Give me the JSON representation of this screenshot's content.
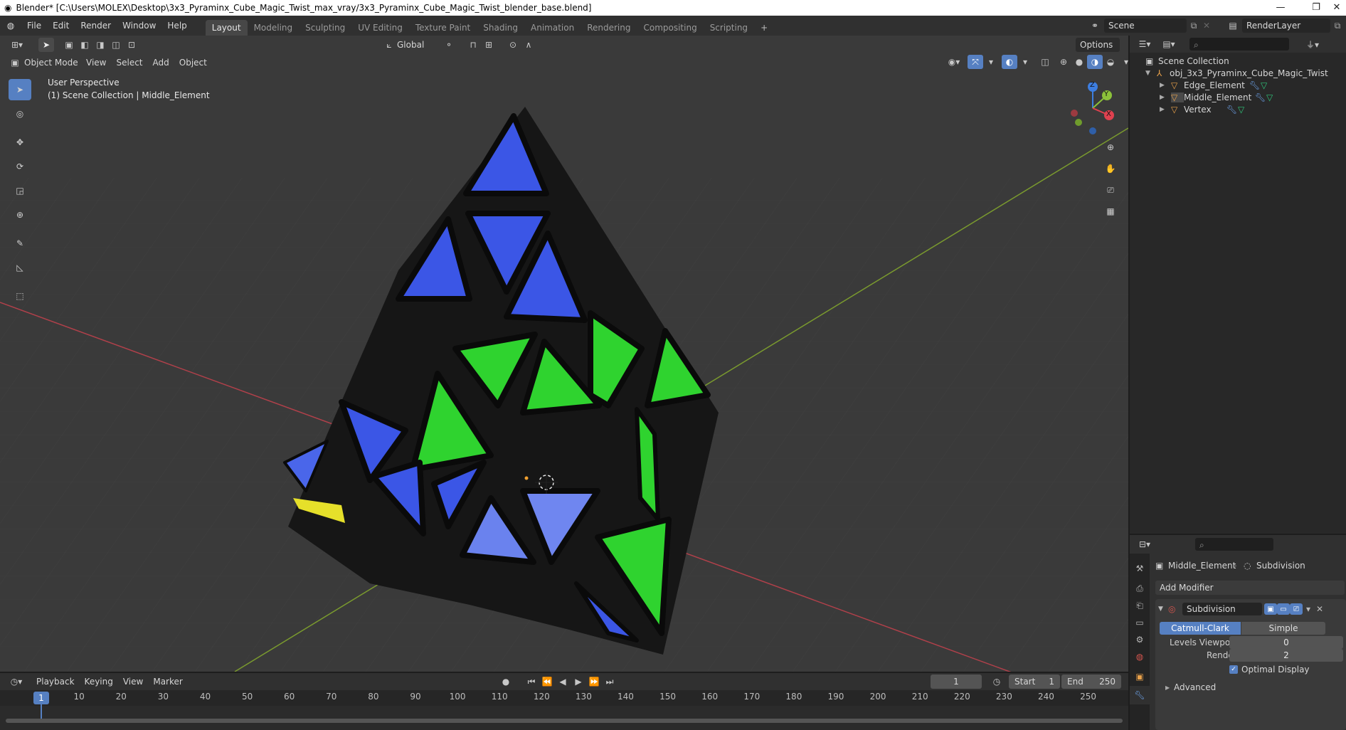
{
  "window": {
    "title": "Blender* [C:\\Users\\MOLEX\\Desktop\\3x3_Pyraminx_Cube_Magic_Twist_max_vray/3x3_Pyraminx_Cube_Magic_Twist_blender_base.blend]",
    "minimize": "—",
    "restore": "❐",
    "close": "✕"
  },
  "menu": [
    "File",
    "Edit",
    "Render",
    "Window",
    "Help"
  ],
  "workspaces": [
    "Layout",
    "Modeling",
    "Sculpting",
    "UV Editing",
    "Texture Paint",
    "Shading",
    "Animation",
    "Rendering",
    "Compositing",
    "Scripting"
  ],
  "active_workspace": "Layout",
  "scene": {
    "name": "Scene",
    "render_layer": "RenderLayer"
  },
  "viewport_header": {
    "mode": "Object Mode",
    "menus": [
      "View",
      "Select",
      "Add",
      "Object"
    ],
    "transform_orientation": "Global",
    "options": "Options"
  },
  "viewport": {
    "perspective": "User Perspective",
    "collection_info": "(1) Scene Collection | Middle_Element",
    "gizmo_axes": {
      "x": "X",
      "y": "Y",
      "z": "Z"
    },
    "colors": {
      "x_axis": "#e0414f",
      "y_axis": "#8cc23a",
      "z_axis": "#3d7ee0",
      "blue": "#3b56e6",
      "green": "#2fd32f",
      "yellow": "#e6e02a"
    }
  },
  "outliner": {
    "root": "Scene Collection",
    "parent": "obj_3x3_Pyraminx_Cube_Magic_Twist",
    "children": [
      "Edge_Element",
      "Middle_Element",
      "Vertex"
    ]
  },
  "properties": {
    "object": "Middle_Element",
    "modifier_context": "Subdivision",
    "add_modifier": "Add Modifier",
    "modifier_name": "Subdivision",
    "algorithm_options": [
      "Catmull-Clark",
      "Simple"
    ],
    "active_algorithm": "Catmull-Clark",
    "levels_viewport_label": "Levels Viewport",
    "levels_viewport": "0",
    "render_label": "Render",
    "render_levels": "2",
    "optimal_display_label": "Optimal Display",
    "optimal_display": true,
    "advanced": "Advanced"
  },
  "timeline": {
    "menus": [
      "Playback",
      "Keying",
      "View",
      "Marker"
    ],
    "current_frame": "1",
    "start_label": "Start",
    "start": "1",
    "end_label": "End",
    "end": "250",
    "ticks": [
      "1",
      "10",
      "20",
      "30",
      "40",
      "50",
      "60",
      "70",
      "80",
      "90",
      "100",
      "110",
      "120",
      "130",
      "140",
      "150",
      "160",
      "170",
      "180",
      "190",
      "200",
      "210",
      "220",
      "230",
      "240",
      "250"
    ]
  }
}
